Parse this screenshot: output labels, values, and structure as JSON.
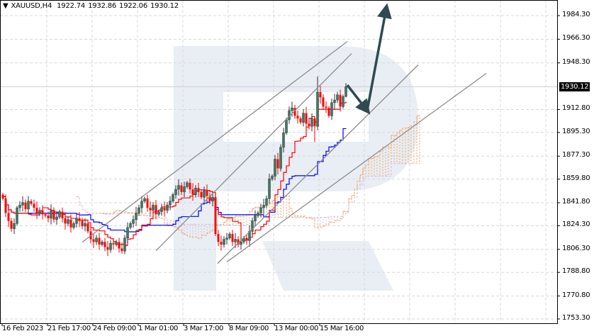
{
  "header": {
    "symbol": "XAUUSD,H4",
    "open": "1922.74",
    "high": "1932.86",
    "low": "1922.06",
    "close": "1930.12"
  },
  "colors": {
    "bull": "#3b7d64",
    "bear": "#ff0000",
    "tenkan": "#ff0000",
    "kijun": "#0000ff",
    "span_a": "#f0a060",
    "span_b": "#d8b8d8",
    "trendline": "#8c8c8c",
    "arrow": "#2f4a50",
    "watermark": "#e9eef4",
    "grid": "#d8d8d8"
  },
  "chart_data": {
    "type": "candlestick",
    "title": "XAUUSD,H4",
    "ylim": [
      1753.3,
      1984.3
    ],
    "grid": true,
    "y_ticks": [
      "1984.30",
      "1966.30",
      "1948.30",
      "1912.80",
      "1895.30",
      "1877.30",
      "1859.80",
      "1841.80",
      "1824.30",
      "1806.30",
      "1788.80",
      "1770.80",
      "1753.30"
    ],
    "current_price": "1930.12",
    "x_ticks": [
      {
        "label": "16 Feb 2023",
        "index": 0
      },
      {
        "label": "21 Feb 17:00",
        "index": 16
      },
      {
        "label": "24 Feb 09:00",
        "index": 32
      },
      {
        "label": "1 Mar 01:00",
        "index": 48
      },
      {
        "label": "3 Mar 17:00",
        "index": 64
      },
      {
        "label": "8 Mar 09:00",
        "index": 80
      },
      {
        "label": "13 Mar 00:00",
        "index": 96
      },
      {
        "label": "15 Mar 16:00",
        "index": 112
      }
    ],
    "close": [
      1845,
      1834,
      1828,
      1822,
      1826,
      1838,
      1840,
      1842,
      1837,
      1843,
      1841,
      1838,
      1834,
      1836,
      1833,
      1832,
      1830,
      1836,
      1829,
      1831,
      1835,
      1830,
      1826,
      1829,
      1823,
      1826,
      1830,
      1828,
      1824,
      1826,
      1820,
      1814,
      1812,
      1815,
      1810,
      1812,
      1808,
      1806,
      1811,
      1810,
      1812,
      1807,
      1805,
      1815,
      1823,
      1826,
      1829,
      1834,
      1838,
      1843,
      1845,
      1838,
      1836,
      1840,
      1833,
      1835,
      1838,
      1836,
      1840,
      1843,
      1848,
      1852,
      1855,
      1850,
      1854,
      1857,
      1852,
      1848,
      1853,
      1850,
      1846,
      1851,
      1847,
      1843,
      1846,
      1818,
      1812,
      1810,
      1814,
      1815,
      1818,
      1812,
      1814,
      1810,
      1812,
      1815,
      1813,
      1820,
      1828,
      1832,
      1834,
      1838,
      1840,
      1845,
      1860,
      1862,
      1875,
      1868,
      1884,
      1895,
      1905,
      1912,
      1914,
      1908,
      1906,
      1903,
      1910,
      1902,
      1900,
      1906,
      1900,
      1926,
      1922,
      1915,
      1914,
      1908,
      1918,
      1920,
      1924,
      1915,
      1922.74,
      1930.12
    ],
    "first_open": 1848,
    "indicator": "Ichimoku (9, 26, 52)",
    "trendlines": [
      {
        "from": [
          28,
          1811.8
        ],
        "to": [
          121.5,
          1964.6
        ]
      },
      {
        "from": [
          54,
          1805.3
        ],
        "to": [
          123,
          1955.4
        ]
      },
      {
        "from": [
          75.75,
          1795.6
        ],
        "to": [
          146.5,
          1946.8
        ]
      },
      {
        "from": [
          79,
          1796.7
        ],
        "to": [
          170.5,
          1940.3
        ]
      }
    ],
    "forecast_arrows": [
      {
        "from": [
          121.5,
          1931.4
        ],
        "to": [
          128.5,
          1912
        ]
      },
      {
        "from": [
          128.5,
          1912
        ],
        "to": [
          135.25,
          1990
        ]
      }
    ]
  }
}
